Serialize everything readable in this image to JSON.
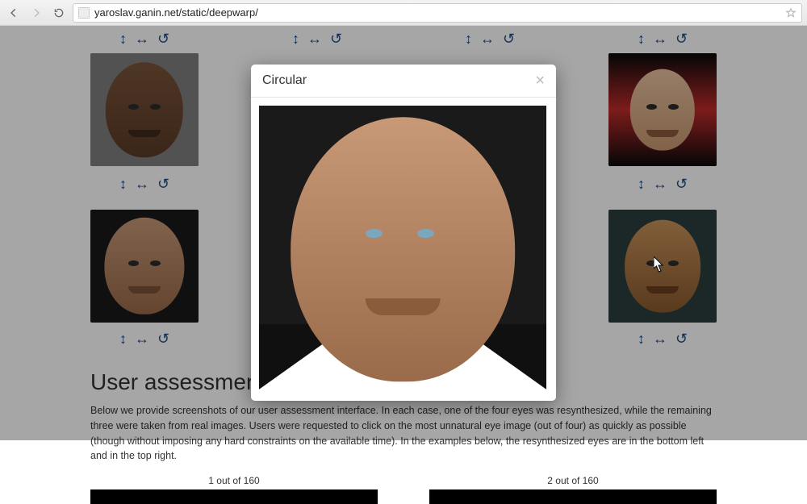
{
  "browser": {
    "url": "yaroslav.ganin.net/static/deepwarp/"
  },
  "modal": {
    "title": "Circular",
    "close": "×"
  },
  "gallery": {
    "controls": {
      "vertical": "↕",
      "horizontal": "↔",
      "reset": "↺"
    }
  },
  "section": {
    "heading": "User assessment interface",
    "paragraph": "Below we provide screenshots of our user assessment interface. In each case, one of the four eyes was resynthesized, while the remaining three were taken from real images. Users were requested to click on the most unnatural eye image (out of four) as quickly as possible (though without imposing any hard constraints on the available time). In the examples below, the resynthesized eyes are in the bottom left and in the top right."
  },
  "counters": {
    "left": "1 out of 160",
    "right": "2 out of 160"
  }
}
